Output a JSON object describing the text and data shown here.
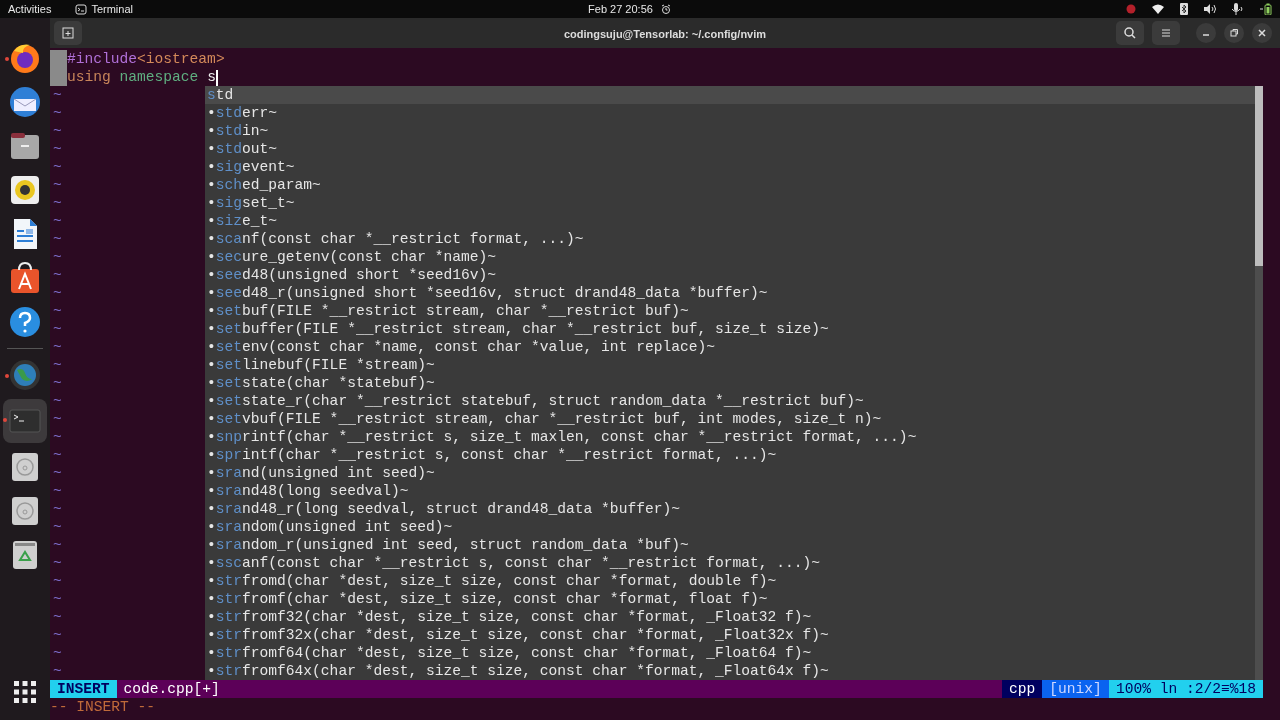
{
  "top_bar": {
    "activities": "Activities",
    "app": "Terminal",
    "clock": "Feb 27  20:56"
  },
  "dock": {
    "items": [
      {
        "kind": "firefox",
        "running": true,
        "active": false
      },
      {
        "kind": "mail",
        "running": false,
        "active": false
      },
      {
        "kind": "files",
        "running": false,
        "active": false
      },
      {
        "kind": "speaker",
        "running": false,
        "active": false
      },
      {
        "kind": "document",
        "running": false,
        "active": false
      },
      {
        "kind": "store",
        "running": false,
        "active": false
      },
      {
        "kind": "help",
        "running": false,
        "active": false
      },
      {
        "kind": "separator"
      },
      {
        "kind": "globe",
        "running": true,
        "active": false
      },
      {
        "kind": "terminal",
        "running": true,
        "active": true
      },
      {
        "kind": "disk",
        "running": false,
        "active": false
      },
      {
        "kind": "disk",
        "running": false,
        "active": false
      },
      {
        "kind": "trash",
        "running": false,
        "active": false
      },
      {
        "kind": "apps-grid",
        "running": false,
        "active": false
      }
    ]
  },
  "window": {
    "title": "codingsuju@Tensorlab: ~/.config/nvim"
  },
  "editor": {
    "lines": [
      {
        "segments": [
          {
            "text": "#include",
            "kind": "preproc"
          },
          {
            "text": "<iostream>",
            "kind": "string"
          }
        ]
      },
      {
        "segments": [
          {
            "text": "using",
            "kind": "keyword"
          },
          {
            "text": " namespace",
            "kind": "type"
          },
          {
            "text": " s",
            "kind": "plain"
          }
        ],
        "cursor": true
      }
    ],
    "tildes": [
      "~",
      "~",
      "~",
      "~",
      "~",
      "~",
      "~",
      "~",
      "~",
      "~",
      "~",
      "~",
      "~",
      "~",
      "~",
      "~",
      "~",
      "~",
      "~",
      "~",
      "~",
      "~",
      "~",
      "~",
      "~",
      "~",
      "~",
      "~",
      "~",
      "~",
      "~",
      "~",
      "~"
    ],
    "completion": {
      "items": [
        {
          "match": "s",
          "rest": "td",
          "selected": true
        },
        {
          "prefix": "•",
          "match": "std",
          "rest": "err~",
          "selected": false
        },
        {
          "prefix": "•",
          "match": "std",
          "rest": "in~",
          "selected": false
        },
        {
          "prefix": "•",
          "match": "std",
          "rest": "out~",
          "selected": false
        },
        {
          "prefix": "•",
          "match": "sig",
          "rest": "event~",
          "selected": false
        },
        {
          "prefix": "•",
          "match": "sch",
          "rest": "ed_param~",
          "selected": false
        },
        {
          "prefix": "•",
          "match": "sig",
          "rest": "set_t~",
          "selected": false
        },
        {
          "prefix": "•",
          "match": "siz",
          "rest": "e_t~",
          "selected": false
        },
        {
          "prefix": "•",
          "match": "sca",
          "rest": "nf(const char *__restrict format, ...)~",
          "selected": false
        },
        {
          "prefix": "•",
          "match": "sec",
          "rest": "ure_getenv(const char *name)~",
          "selected": false
        },
        {
          "prefix": "•",
          "match": "see",
          "rest": "d48(unsigned short *seed16v)~",
          "selected": false
        },
        {
          "prefix": "•",
          "match": "see",
          "rest": "d48_r(unsigned short *seed16v, struct drand48_data *buffer)~",
          "selected": false
        },
        {
          "prefix": "•",
          "match": "set",
          "rest": "buf(FILE *__restrict stream, char *__restrict buf)~",
          "selected": false
        },
        {
          "prefix": "•",
          "match": "set",
          "rest": "buffer(FILE *__restrict stream, char *__restrict buf, size_t size)~",
          "selected": false
        },
        {
          "prefix": "•",
          "match": "set",
          "rest": "env(const char *name, const char *value, int replace)~",
          "selected": false
        },
        {
          "prefix": "•",
          "match": "set",
          "rest": "linebuf(FILE *stream)~",
          "selected": false
        },
        {
          "prefix": "•",
          "match": "set",
          "rest": "state(char *statebuf)~",
          "selected": false
        },
        {
          "prefix": "•",
          "match": "set",
          "rest": "state_r(char *__restrict statebuf, struct random_data *__restrict buf)~",
          "selected": false
        },
        {
          "prefix": "•",
          "match": "set",
          "rest": "vbuf(FILE *__restrict stream, char *__restrict buf, int modes, size_t n)~",
          "selected": false
        },
        {
          "prefix": "•",
          "match": "snp",
          "rest": "rintf(char *__restrict s, size_t maxlen, const char *__restrict format, ...)~",
          "selected": false
        },
        {
          "prefix": "•",
          "match": "spr",
          "rest": "intf(char *__restrict s, const char *__restrict format, ...)~",
          "selected": false
        },
        {
          "prefix": "•",
          "match": "sra",
          "rest": "nd(unsigned int seed)~",
          "selected": false
        },
        {
          "prefix": "•",
          "match": "sra",
          "rest": "nd48(long seedval)~",
          "selected": false
        },
        {
          "prefix": "•",
          "match": "sra",
          "rest": "nd48_r(long seedval, struct drand48_data *buffer)~",
          "selected": false
        },
        {
          "prefix": "•",
          "match": "sra",
          "rest": "ndom(unsigned int seed)~",
          "selected": false
        },
        {
          "prefix": "•",
          "match": "sra",
          "rest": "ndom_r(unsigned int seed, struct random_data *buf)~",
          "selected": false
        },
        {
          "prefix": "•",
          "match": "ssc",
          "rest": "anf(const char *__restrict s, const char *__restrict format, ...)~",
          "selected": false
        },
        {
          "prefix": "•",
          "match": "str",
          "rest": "fromd(char *dest, size_t size, const char *format, double f)~",
          "selected": false
        },
        {
          "prefix": "•",
          "match": "str",
          "rest": "fromf(char *dest, size_t size, const char *format, float f)~",
          "selected": false
        },
        {
          "prefix": "•",
          "match": "str",
          "rest": "fromf32(char *dest, size_t size, const char *format, _Float32 f)~",
          "selected": false
        },
        {
          "prefix": "•",
          "match": "str",
          "rest": "fromf32x(char *dest, size_t size, const char *format, _Float32x f)~",
          "selected": false
        },
        {
          "prefix": "•",
          "match": "str",
          "rest": "fromf64(char *dest, size_t size, const char *format, _Float64 f)~",
          "selected": false
        },
        {
          "prefix": "•",
          "match": "str",
          "rest": "fromf64x(char *dest, size_t size, const char *format, _Float64x f)~",
          "selected": false
        }
      ]
    },
    "statusline": {
      "mode": "INSERT",
      "file": "code.cpp[+]",
      "filetype": "cpp",
      "format": "[unix]",
      "position": "100% ln :2/2≡%18"
    },
    "cmdline": "-- INSERT --"
  }
}
